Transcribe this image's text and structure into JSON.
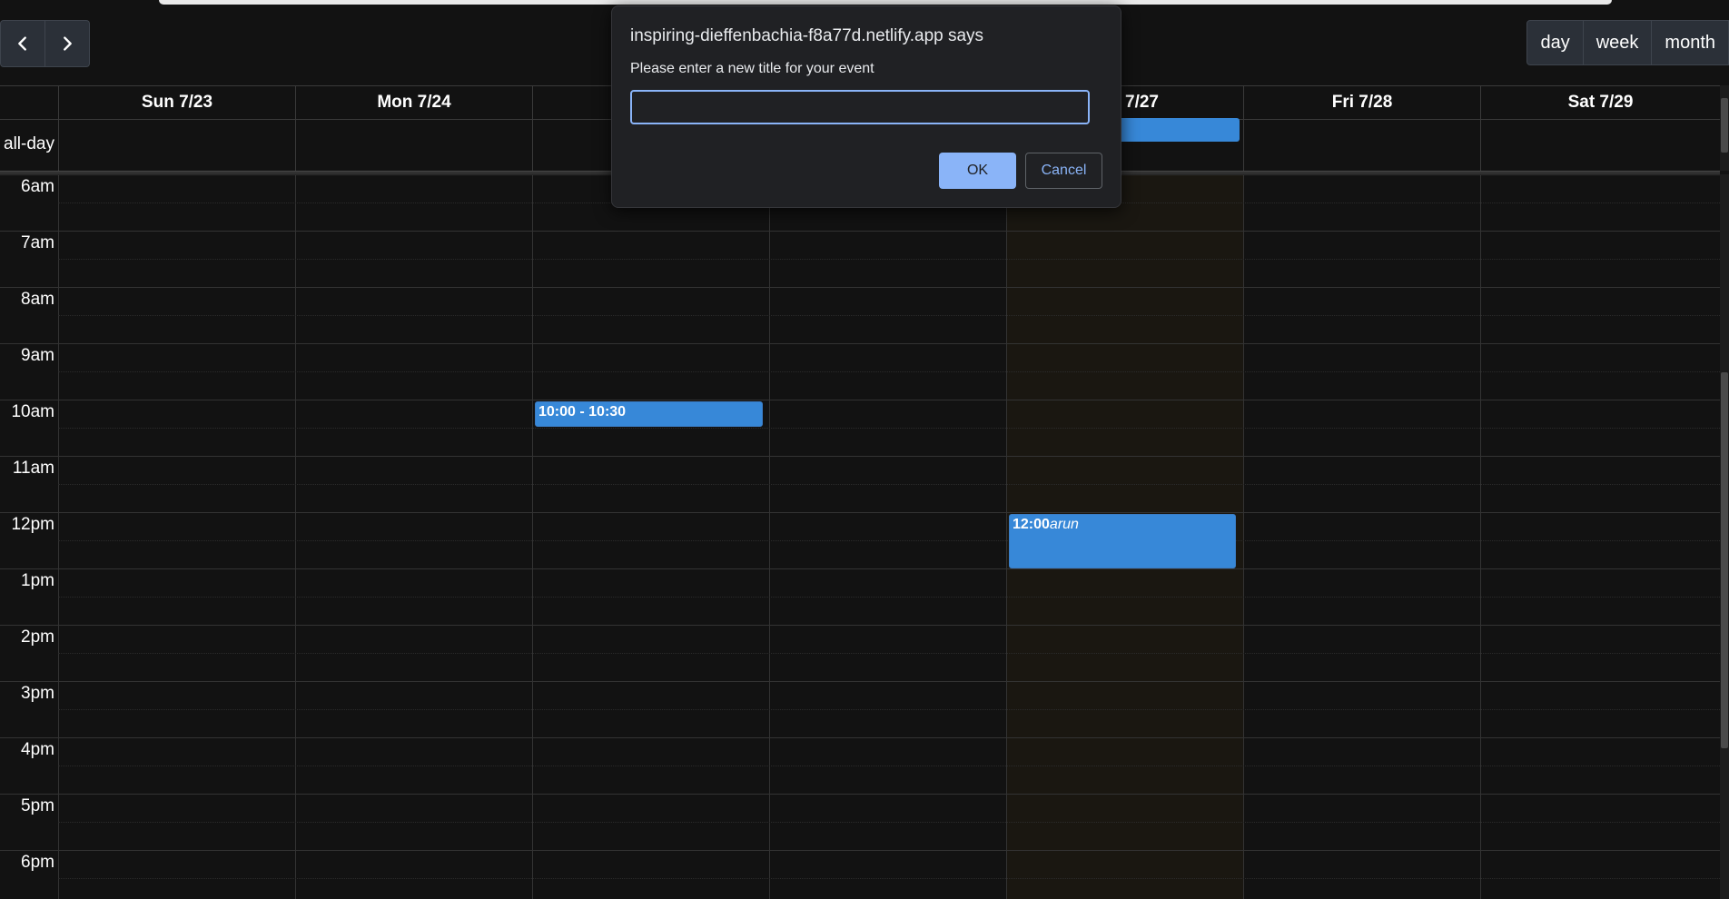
{
  "toolbar": {
    "prev_icon": "chevron-left-icon",
    "next_icon": "chevron-right-icon",
    "views": [
      "day",
      "week",
      "month"
    ]
  },
  "calendar": {
    "allday_label": "all-day",
    "days": [
      {
        "label": "Sun 7/23"
      },
      {
        "label": "Mon 7/24"
      },
      {
        "label": ""
      },
      {
        "label": ""
      },
      {
        "label": "7/27"
      },
      {
        "label": "Fri 7/28"
      },
      {
        "label": "Sat 7/29"
      }
    ],
    "hours": [
      "6am",
      "7am",
      "8am",
      "9am",
      "10am",
      "11am",
      "12pm",
      "1pm",
      "2pm",
      "3pm",
      "4pm",
      "5pm",
      "6pm"
    ],
    "events": [
      {
        "time": "10:00 - 10:30",
        "title": ""
      },
      {
        "time": "12:00",
        "title": "arun"
      }
    ]
  },
  "dialog": {
    "origin": "inspiring-dieffenbachia-f8a77d.netlify.app says",
    "message": "Please enter a new title for your event",
    "input_value": "",
    "ok_label": "OK",
    "cancel_label": "Cancel"
  },
  "colors": {
    "event": "#3788d8",
    "today_bg": "#1a1711",
    "dialog_button": "#8ab4f8"
  }
}
